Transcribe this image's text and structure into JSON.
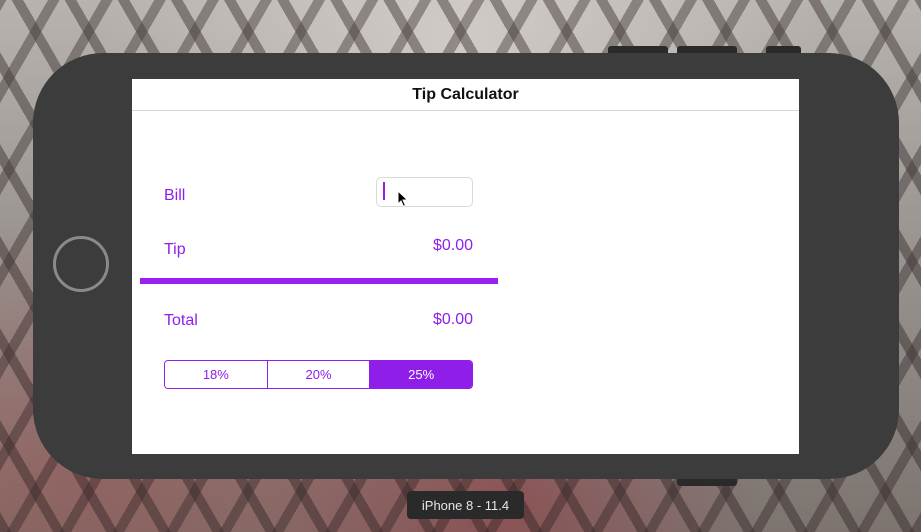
{
  "app": {
    "title": "Tip Calculator"
  },
  "form": {
    "bill_label": "Bill",
    "bill_value": "",
    "tip_label": "Tip",
    "tip_value": "$0.00",
    "total_label": "Total",
    "total_value": "$0.00"
  },
  "tip_options": {
    "items": [
      "18%",
      "20%",
      "25%"
    ],
    "selected": "25%"
  },
  "simulator": {
    "device_label": "iPhone 8 - 11.4"
  },
  "colors": {
    "accent": "#8f1ee8",
    "divider": "#9b1ff0",
    "device_body": "#3c3c3c"
  },
  "icons": {
    "home_button": "home-button-icon",
    "mouse_pointer": "mouse-pointer-icon"
  }
}
